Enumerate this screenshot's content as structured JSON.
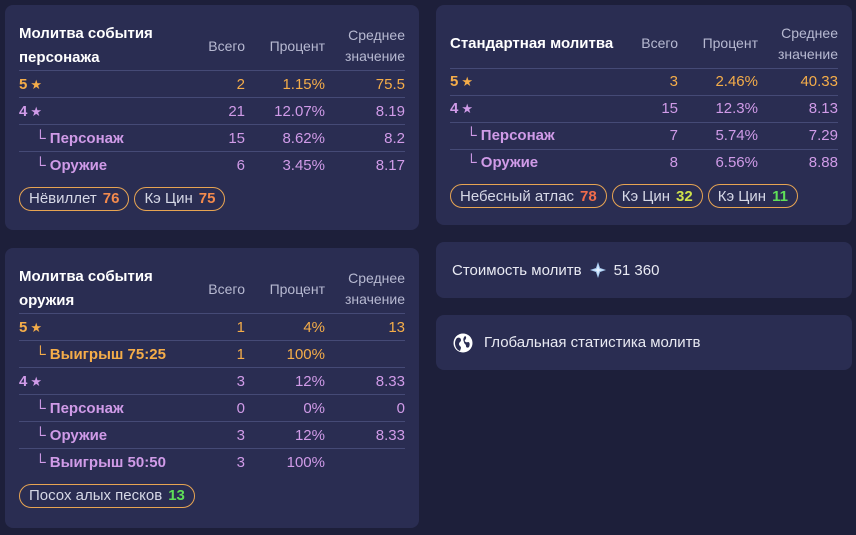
{
  "character_event": {
    "title_line1": "Молитва события",
    "title_line2": "персонажа",
    "headers": {
      "total": "Всего",
      "percent": "Процент",
      "avg_line1": "Среднее",
      "avg_line2": "значение"
    },
    "rows": {
      "five": {
        "label": "5",
        "total": "2",
        "percent": "1.15%",
        "avg": "75.5"
      },
      "four": {
        "label": "4",
        "total": "21",
        "percent": "12.07%",
        "avg": "8.19"
      },
      "four_character": {
        "label": "└ Персонаж",
        "total": "15",
        "percent": "8.62%",
        "avg": "8.2"
      },
      "four_weapon": {
        "label": "└ Оружие",
        "total": "6",
        "percent": "3.45%",
        "avg": "8.17"
      }
    },
    "pulls": [
      {
        "name": "Нёвиллет",
        "count": "76"
      },
      {
        "name": "Кэ Цин",
        "count": "75"
      }
    ]
  },
  "weapon_event": {
    "title_line1": "Молитва события",
    "title_line2": "оружия",
    "headers": {
      "total": "Всего",
      "percent": "Процент",
      "avg_line1": "Среднее",
      "avg_line2": "значение"
    },
    "rows": {
      "five": {
        "label": "5",
        "total": "1",
        "percent": "4%",
        "avg": "13"
      },
      "five_win": {
        "label": "└ Выигрыш 75:25",
        "total": "1",
        "percent": "100%",
        "avg": ""
      },
      "four": {
        "label": "4",
        "total": "3",
        "percent": "12%",
        "avg": "8.33"
      },
      "four_character": {
        "label": "└ Персонаж",
        "total": "0",
        "percent": "0%",
        "avg": "0"
      },
      "four_weapon": {
        "label": "└ Оружие",
        "total": "3",
        "percent": "12%",
        "avg": "8.33"
      },
      "four_win": {
        "label": "└ Выигрыш 50:50",
        "total": "3",
        "percent": "100%",
        "avg": ""
      }
    },
    "pulls": [
      {
        "name": "Посох алых песков",
        "count": "13"
      }
    ]
  },
  "standard": {
    "title": "Стандартная молитва",
    "headers": {
      "total": "Всего",
      "percent": "Процент",
      "avg_line1": "Среднее",
      "avg_line2": "значение"
    },
    "rows": {
      "five": {
        "label": "5",
        "total": "3",
        "percent": "2.46%",
        "avg": "40.33"
      },
      "four": {
        "label": "4",
        "total": "15",
        "percent": "12.3%",
        "avg": "8.13"
      },
      "four_character": {
        "label": "└ Персонаж",
        "total": "7",
        "percent": "5.74%",
        "avg": "7.29"
      },
      "four_weapon": {
        "label": "└ Оружие",
        "total": "8",
        "percent": "6.56%",
        "avg": "8.88"
      }
    },
    "pulls": [
      {
        "name": "Небесный атлас",
        "count": "78"
      },
      {
        "name": "Кэ Цин",
        "count": "32"
      },
      {
        "name": "Кэ Цин",
        "count": "11"
      }
    ]
  },
  "cost": {
    "label": "Стоимость молитв",
    "value": "51 360",
    "icon": "primogem-icon"
  },
  "global": {
    "label": "Глобальная статистика молитв",
    "icon": "globe-icon"
  },
  "colors": {
    "background": "#1d1f3a",
    "card": "#2a2d52",
    "gold": "#f5ad49",
    "purple": "#d09be8",
    "pity_red": "#ef6c4b",
    "pity_orange": "#f38a4d",
    "pity_yellow": "#cfe24b",
    "pity_green": "#5fdf58"
  }
}
